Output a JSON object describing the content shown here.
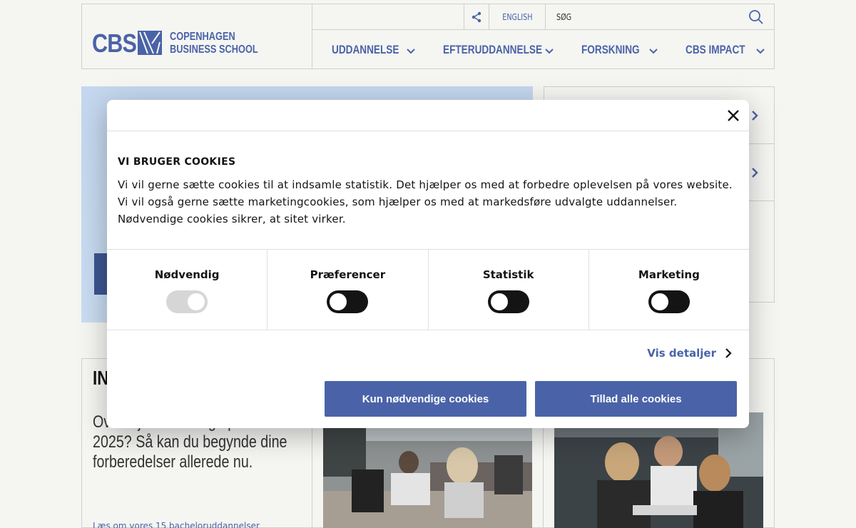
{
  "header": {
    "logo_abbrev": "CBS",
    "logo_line1": "COPENHAGEN",
    "logo_line2": "BUSINESS SCHOOL",
    "language_label": "ENGLISH",
    "search_label": "SØG",
    "nav": [
      {
        "label": "UDDANNELSE"
      },
      {
        "label": "EFTERUDDANNELSE"
      },
      {
        "label": "FORSKNING"
      },
      {
        "label": "CBS IMPACT"
      }
    ]
  },
  "content": {
    "card1_heading": "IN",
    "card1_line1": "Overvejer du at søge på CBS i",
    "card1_line2": "2025? Så kan du begynde dine",
    "card1_line3": "forberedelser allerede nu.",
    "card1_link": "Læs om vores 15 bacheloruddannelser"
  },
  "cookie_modal": {
    "title": "VI BRUGER COOKIES",
    "text": "Vi vil gerne sætte cookies til at indsamle statistik. Det hjælper os med at forbedre oplevelsen på vores website. Vi vil også gerne sætte marketingcookies, som hjælper os med at markedsføre udvalgte uddannelser. Nødvendige cookies sikrer, at sitet virker.",
    "categories": [
      {
        "label": "Nødvendig",
        "enabled": true,
        "locked": true
      },
      {
        "label": "Præferencer",
        "enabled": false,
        "locked": false
      },
      {
        "label": "Statistik",
        "enabled": false,
        "locked": false
      },
      {
        "label": "Marketing",
        "enabled": false,
        "locked": false
      }
    ],
    "details_link": "Vis detaljer",
    "btn_necessary": "Kun nødvendige cookies",
    "btn_all": "Tillad alle cookies"
  },
  "colors": {
    "brand": "#4a63a8",
    "background": "#f5f5f2",
    "toggle_off": "#141414"
  }
}
